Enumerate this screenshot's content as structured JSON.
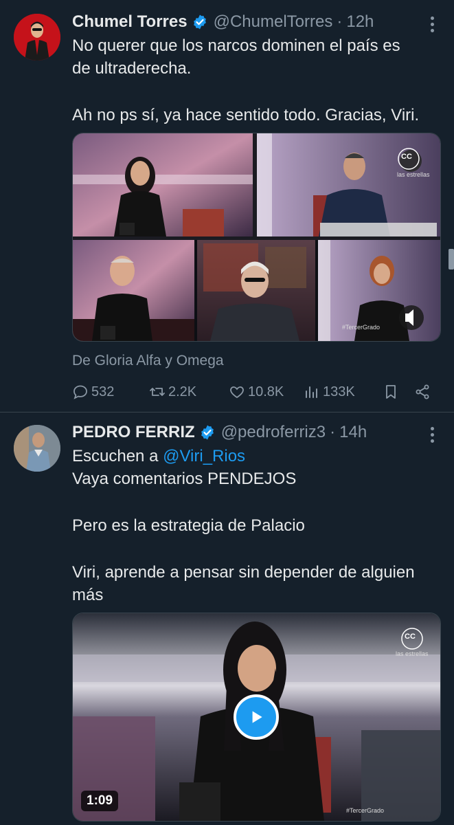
{
  "tweets": [
    {
      "author_name": "Chumel Torres",
      "handle": "@ChumelTorres",
      "time": "12h",
      "lines": [
        "No querer que los narcos dominen el país es",
        "de ultraderecha.",
        "",
        "Ah no ps sí, ya hace sentido todo. Gracias, Viri."
      ],
      "media": {
        "cc_badge": "CC",
        "channel_text": "las estrellas",
        "hashtag": "#TercerGrado"
      },
      "source": "De Gloria Alfa y Omega",
      "stats": {
        "replies": "532",
        "retweets": "2.2K",
        "likes": "10.8K",
        "views": "133K"
      }
    },
    {
      "author_name": "PEDRO FERRIZ",
      "handle": "@pedroferriz3",
      "time": "14h",
      "lines_prefix": "Escuchen a ",
      "mention": "@Viri_Rios",
      "lines": [
        "Vaya comentarios PENDEJOS",
        "",
        "Pero es la estrategia de Palacio",
        "",
        "Viri, aprende a pensar sin depender de alguien",
        "más"
      ],
      "media": {
        "cc_badge": "CC",
        "channel_text": "las estrellas",
        "hashtag": "#TercerGrado",
        "duration": "1:09"
      }
    }
  ],
  "colors": {
    "background": "#15202b",
    "text": "#e7e9ea",
    "muted": "#8b98a5",
    "accent": "#1d9bf0",
    "divider": "#38444d"
  },
  "icons": [
    "verified-badge-icon",
    "more-options-icon",
    "reply-icon",
    "retweet-icon",
    "like-icon",
    "views-icon",
    "bookmark-icon",
    "share-icon",
    "play-icon",
    "mute-icon"
  ]
}
